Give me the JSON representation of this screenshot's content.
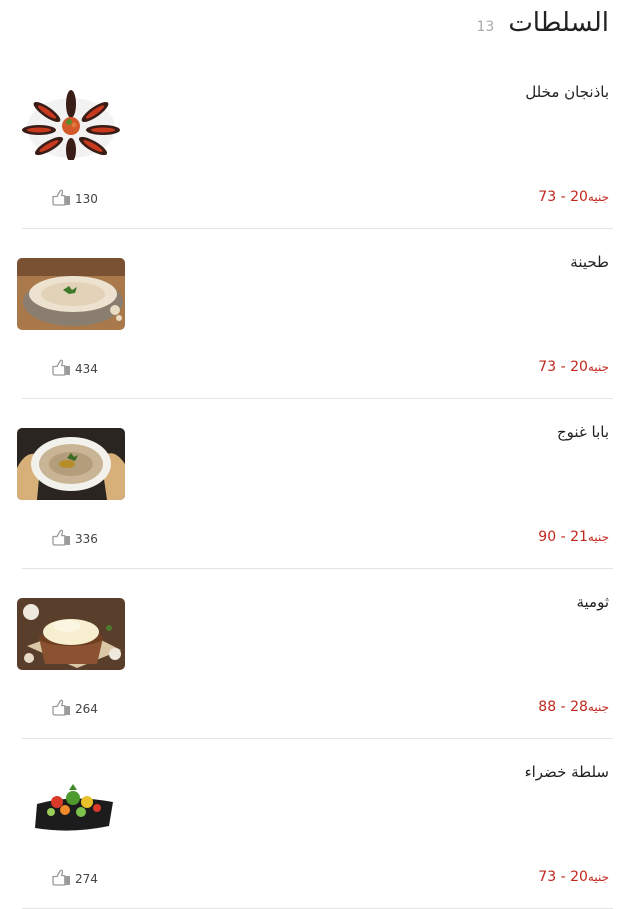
{
  "header": {
    "title": "السلطات",
    "count": "13"
  },
  "items": [
    {
      "name": "باذنجان مخلل",
      "price_range": "20 - 73",
      "currency": "جنيه",
      "likes": "130",
      "image": "eggplant"
    },
    {
      "name": "طحينة",
      "price_range": "20 - 73",
      "currency": "جنيه",
      "likes": "434",
      "image": "tahini"
    },
    {
      "name": "بابا غنوج",
      "price_range": "21 - 90",
      "currency": "جنيه",
      "likes": "336",
      "image": "babaganoush"
    },
    {
      "name": "ثومية",
      "price_range": "28 - 88",
      "currency": "جنيه",
      "likes": "264",
      "image": "toumia"
    },
    {
      "name": "سلطة خضراء",
      "price_range": "20 - 73",
      "currency": "جنيه",
      "likes": "274",
      "image": "greensalad"
    }
  ],
  "colors": {
    "price": "#c0281c",
    "divider": "#e4e4e4",
    "count": "#aaaaaa"
  }
}
